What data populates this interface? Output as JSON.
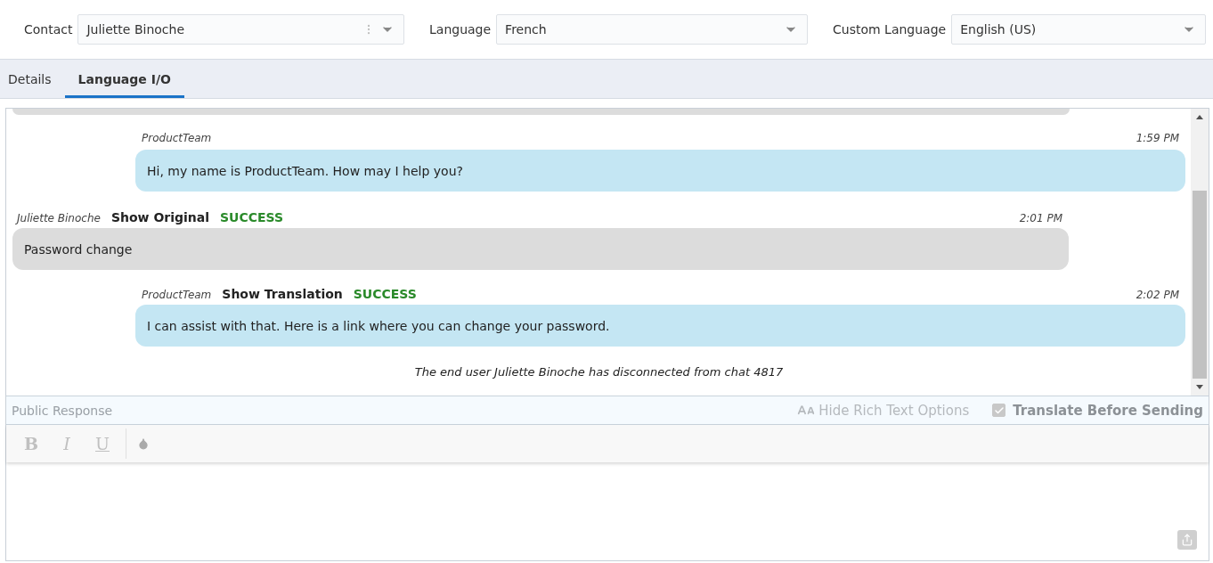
{
  "fields": [
    {
      "label": "Contact",
      "value": "Juliette Binoche",
      "has_menu": true
    },
    {
      "label": "Language",
      "value": "French",
      "has_menu": false
    },
    {
      "label": "Custom Language",
      "value": "English (US)",
      "has_menu": false
    }
  ],
  "tabs": [
    {
      "label": "Details",
      "selected": false
    },
    {
      "label": "Language I/O",
      "selected": true
    }
  ],
  "messages": [
    {
      "kind": "agent",
      "author": "ProductTeam",
      "time": "1:59 PM",
      "text": "Hi, my name is ProductTeam. How may I help you?"
    },
    {
      "kind": "customer",
      "author": "Juliette Binoche",
      "action": "Show Original",
      "status": "SUCCESS",
      "time": "2:01 PM",
      "text": "Password change"
    },
    {
      "kind": "agent",
      "author": "ProductTeam",
      "action": "Show Translation",
      "status": "SUCCESS",
      "time": "2:02 PM",
      "text": "I can assist with that. Here is a link where you can change your password."
    }
  ],
  "notice": "The end user Juliette Binoche has disconnected from chat 4817",
  "response": {
    "label": "Public Response",
    "rich_text_toggle": "Hide Rich Text Options",
    "translate": {
      "label": "Translate Before Sending",
      "checked": true
    },
    "format_buttons": [
      "B",
      "I",
      "U"
    ]
  }
}
